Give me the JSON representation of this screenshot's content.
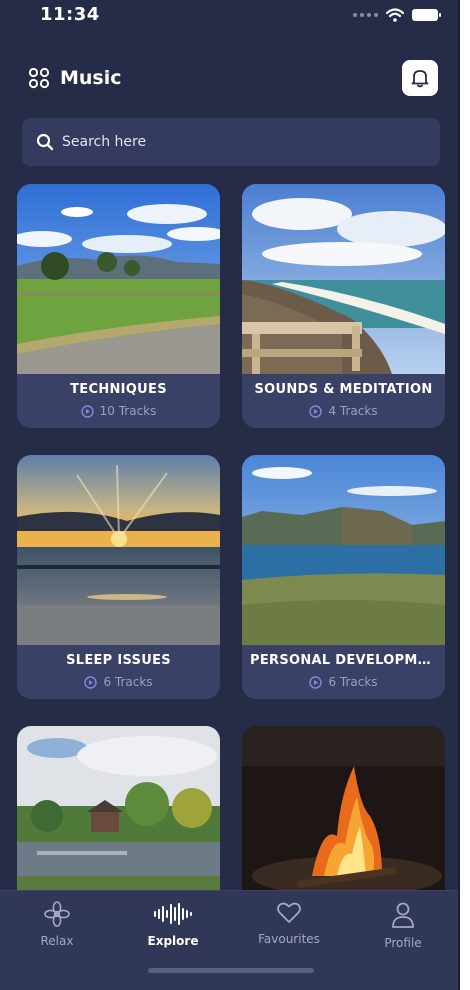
{
  "status_bar": {
    "time": "11:34"
  },
  "header": {
    "title": "Music",
    "grid_icon": "grid-icon",
    "bell_icon": "bell-icon"
  },
  "search": {
    "placeholder": "Search here"
  },
  "cards": [
    {
      "title": "TECHNIQUES",
      "tracks": "10 Tracks",
      "scene": "green field with blue sky and hills"
    },
    {
      "title": "SOUNDS & MEDITATION",
      "tracks": "4 Tracks",
      "scene": "beach with wooden boardwalk"
    },
    {
      "title": "SLEEP ISSUES",
      "tracks": "6 Tracks",
      "scene": "sunset over sea"
    },
    {
      "title": "PERSONAL DEVELOPME...",
      "tracks": "6 Tracks",
      "scene": "coastal cliffs and sea"
    },
    {
      "title": "",
      "tracks": "",
      "scene": "lake with trees and house"
    },
    {
      "title": "",
      "tracks": "",
      "scene": "campfire at night"
    }
  ],
  "tabs": [
    {
      "label": "Relax",
      "icon": "flower-icon",
      "active": false
    },
    {
      "label": "Explore",
      "icon": "waveform-icon",
      "active": true
    },
    {
      "label": "Favourites",
      "icon": "heart-icon",
      "active": false
    },
    {
      "label": "Profile",
      "icon": "person-icon",
      "active": false
    }
  ],
  "colors": {
    "background": "#262b47",
    "card": "#3a4166",
    "search": "#353b5e",
    "tab_bar": "#313756"
  }
}
